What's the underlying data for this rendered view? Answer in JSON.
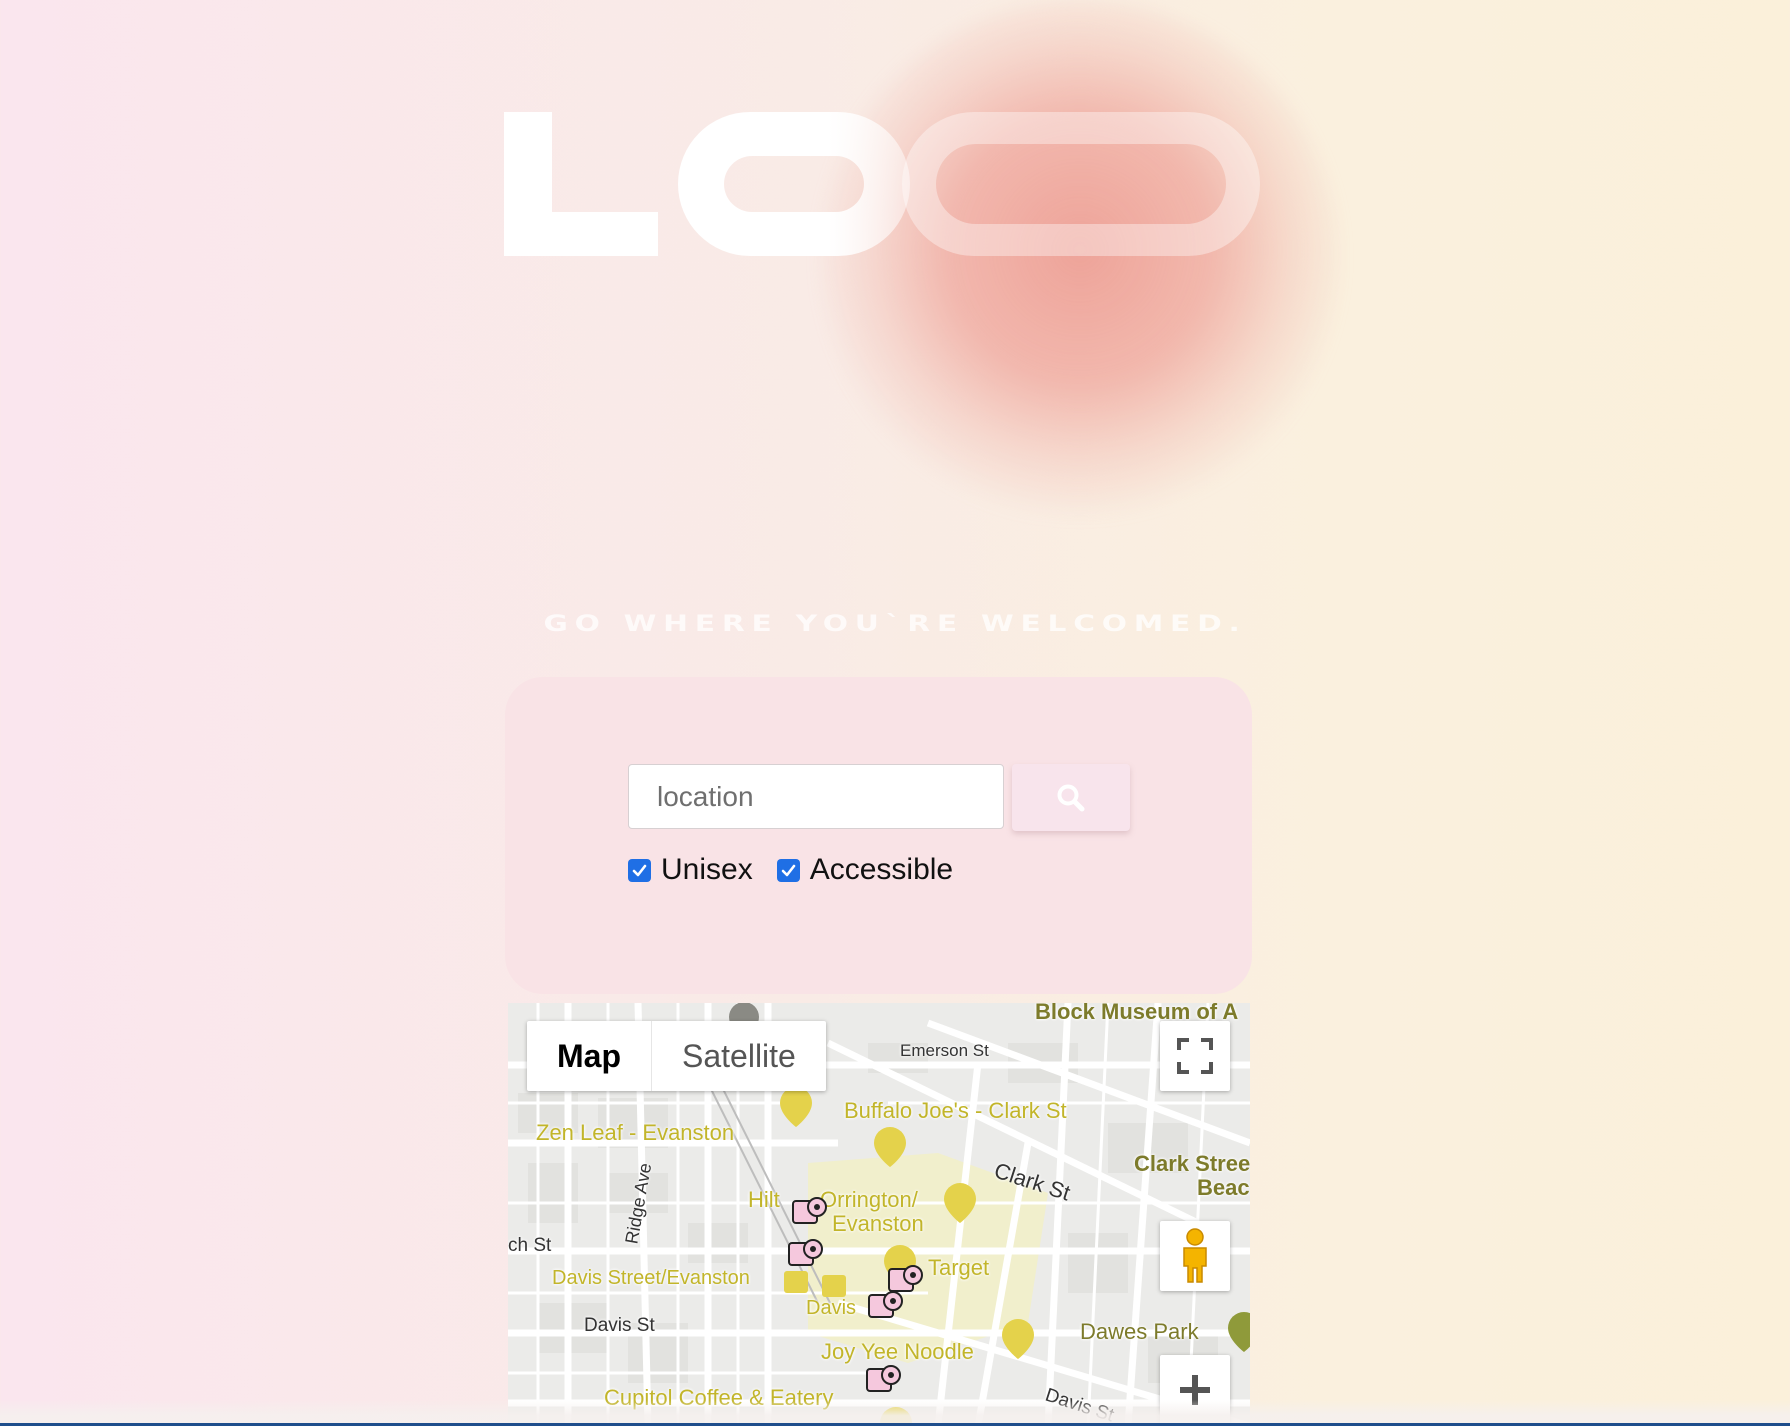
{
  "brand": {
    "logo_text": "LOO"
  },
  "tagline": "GO WHERE YOU`RE WELCOMED.",
  "search": {
    "placeholder": "location",
    "button_icon": "search-icon"
  },
  "filters": [
    {
      "label": "Unisex",
      "checked": true
    },
    {
      "label": "Accessible",
      "checked": true
    }
  ],
  "map": {
    "type_controls": {
      "map_label": "Map",
      "satellite_label": "Satellite",
      "selected": "Map"
    },
    "controls": [
      "fullscreen-icon",
      "pegman-icon",
      "zoom-in-icon"
    ],
    "labels": {
      "block_museum": "Block Museum of A",
      "emerson": "Emerson St",
      "buffalo_joes": "Buffalo Joe's - Clark St",
      "zen_leaf": "Zen Leaf - Evanston",
      "clark_st": "Clark St",
      "clark_street_beach_1": "Clark Stree",
      "clark_street_beach_2": "Beac",
      "ridge_ave": "Ridge Ave",
      "hilton": "Hilt",
      "orrington_1": "Orrington/",
      "orrington_2": "Evanston",
      "church_st": "ch St",
      "target": "Target",
      "davis_station": "Davis Street/Evanston",
      "davis_metro": "Davis",
      "davis_st_left": "Davis St",
      "dawes_park": "Dawes Park",
      "joy_yee": "Joy Yee Noodle",
      "davis_st_right": "Davis St",
      "cupitol": "Cupitol Coffee & Eatery"
    },
    "restroom_marker_count": 5,
    "colors": {
      "poi_yellow": "#c2b52a",
      "restroom_marker": "#f5c8dd"
    }
  },
  "colors": {
    "search_card": "#f9e3e6",
    "checkbox": "#1f6fe5",
    "blob": "#ec968c"
  }
}
